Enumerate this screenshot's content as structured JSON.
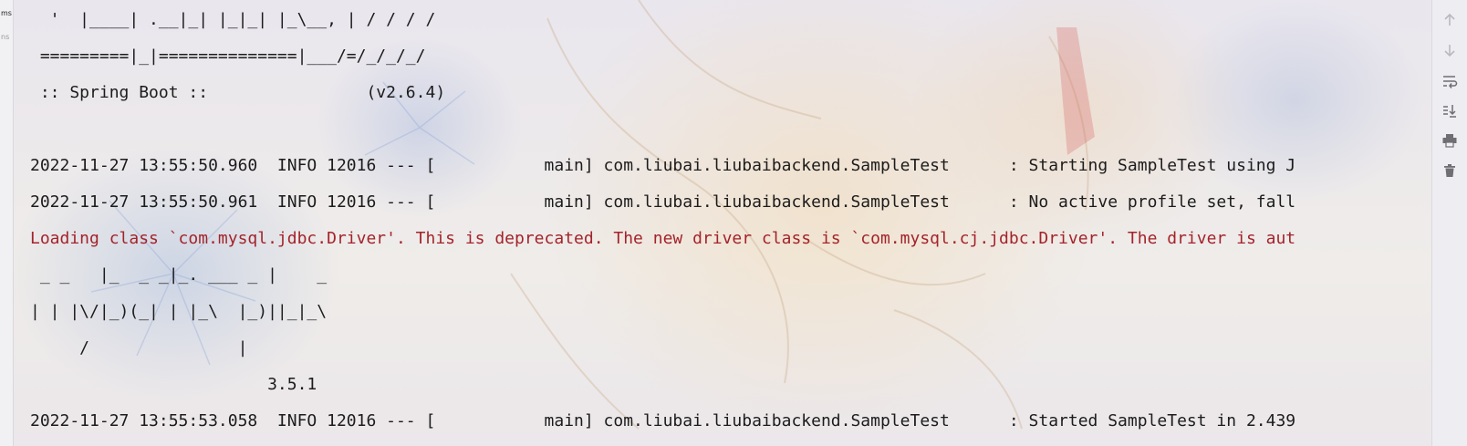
{
  "left_gutter": {
    "tabs": [
      "ms",
      "ns"
    ]
  },
  "console": {
    "lines": [
      "  '  |____| .__|_| |_|_| |_\\__, | / / / /",
      " =========|_|==============|___/=/_/_/_/",
      " :: Spring Boot ::                (v2.6.4)",
      "",
      "2022-11-27 13:55:50.960  INFO 12016 --- [           main] com.liubai.liubaibackend.SampleTest      : Starting SampleTest using J",
      "2022-11-27 13:55:50.961  INFO 12016 --- [           main] com.liubai.liubaibackend.SampleTest      : No active profile set, fall",
      "Loading class `com.mysql.jdbc.Driver'. This is deprecated. The new driver class is `com.mysql.cj.jdbc.Driver'. The driver is aut",
      " _ _   |_  _ _|_. ___ _ |    _",
      "| | |\\/|_)(_| | |_\\  |_)||_|_\\",
      "     /               |",
      "                        3.5.1",
      "2022-11-27 13:55:53.058  INFO 12016 --- [           main] com.liubai.liubaibackend.SampleTest      : Started SampleTest in 2.439"
    ]
  },
  "toolbar": {
    "icons": [
      "arrow-up-icon",
      "arrow-down-icon",
      "soft-wrap-icon",
      "scroll-to-end-icon",
      "print-icon",
      "trash-icon"
    ]
  },
  "colors": {
    "text": "#1c1c1c",
    "error_text": "#a4232a",
    "background": "#eceaf0"
  }
}
